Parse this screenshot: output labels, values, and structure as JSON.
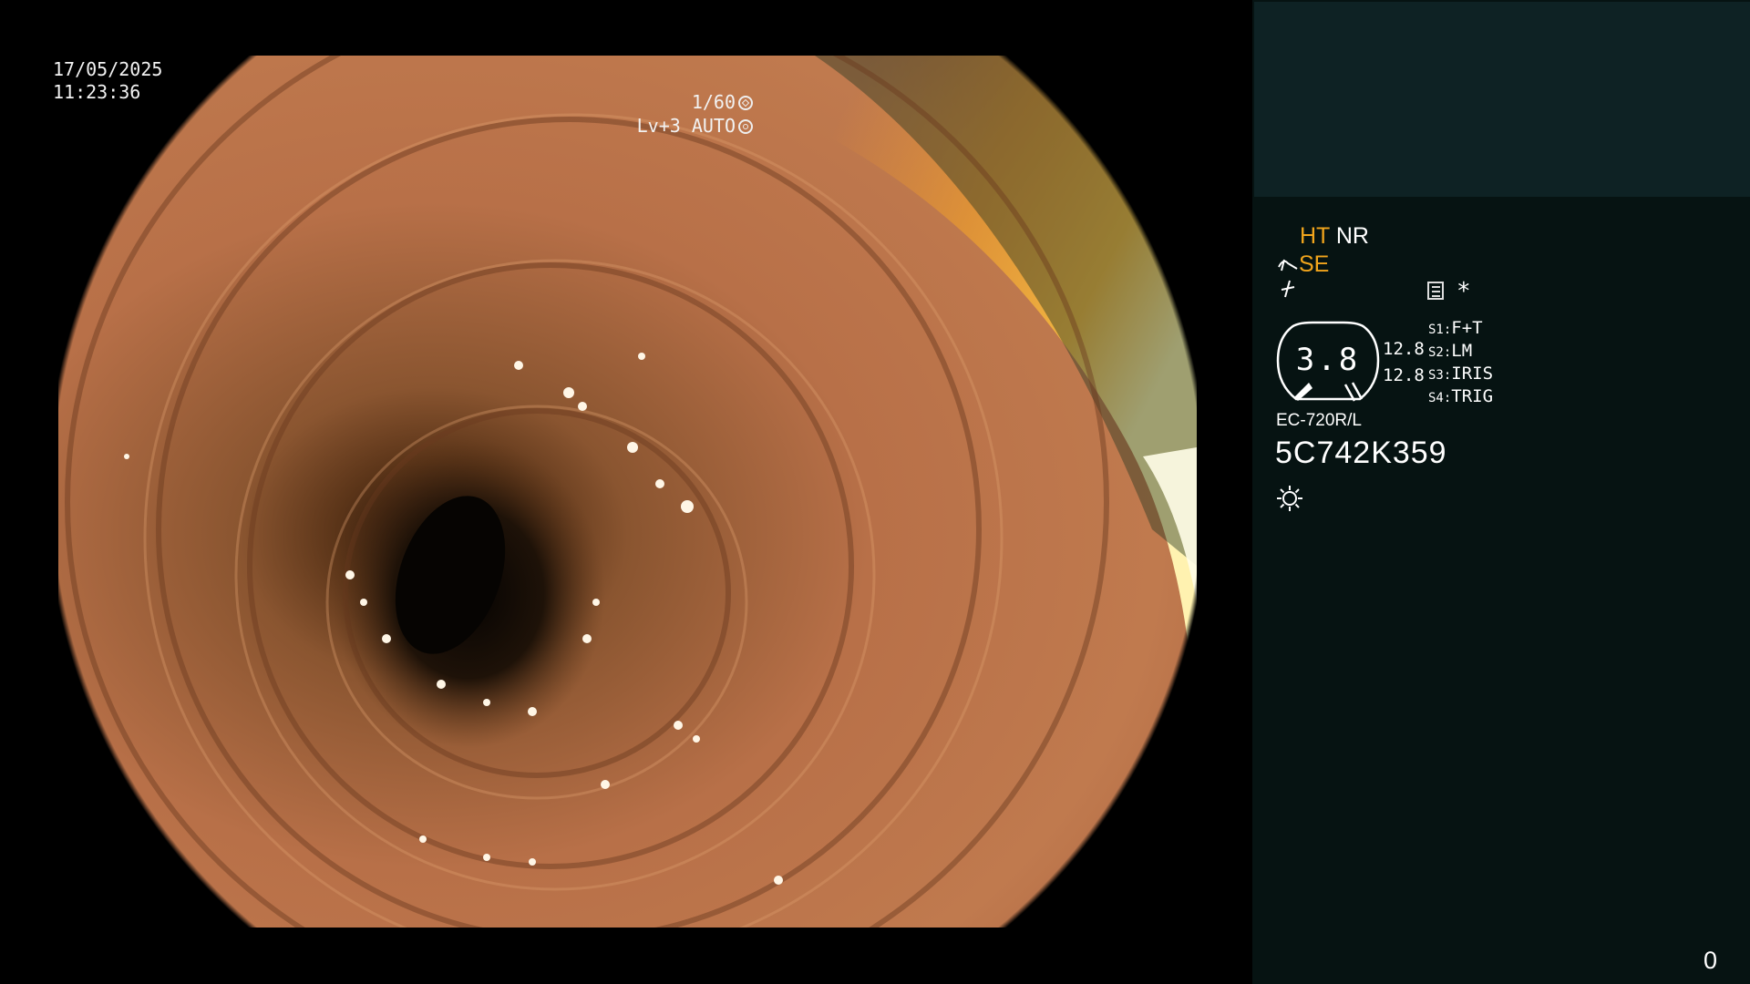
{
  "overlay": {
    "date": "17/05/2025",
    "time": "11:23:36",
    "shutter_speed": "1/60",
    "level": "Lv+3 AUTO"
  },
  "panel": {
    "mode_ht": "HT",
    "mode_nr": "NR",
    "mode_se": "SE",
    "dial_value": "3.8",
    "value_a": "12.8",
    "value_b": "12.8",
    "switches": [
      {
        "key": "S1:",
        "label": "F+T"
      },
      {
        "key": "S2:",
        "label": "LM"
      },
      {
        "key": "S3:",
        "label": "IRIS"
      },
      {
        "key": "S4:",
        "label": "TRIG"
      }
    ],
    "star": "*",
    "scope_model": "EC-720R/L",
    "scope_serial": "5C742K359",
    "counter": "0"
  },
  "colors": {
    "accent": "#f2a51c",
    "panel_bg": "#061312",
    "panel_top_bg": "#0e2224"
  },
  "icons": [
    "aperture-icon",
    "auto-iris-icon",
    "bending-icon",
    "enhance-icon",
    "menu-icon",
    "light-source-icon"
  ]
}
